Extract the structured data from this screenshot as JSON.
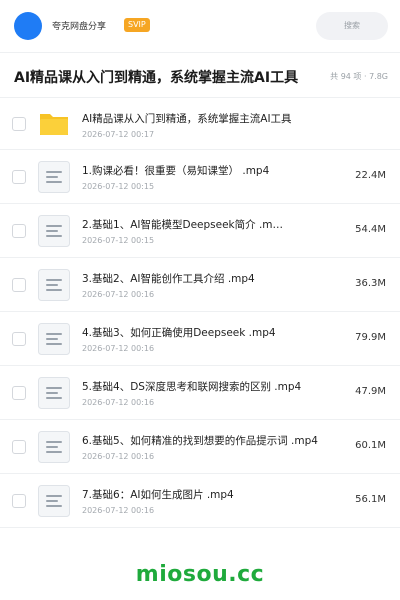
{
  "header": {
    "username": "夸克网盘分享",
    "badge": "SVIP",
    "search_placeholder": "搜索",
    "avatar_color": "#1f7cf5",
    "badge_color": "#f6a623"
  },
  "share": {
    "title": "AI精品课从入门到精通，系统掌握主流AI工具",
    "meta": "共 94 项 · 7.8G"
  },
  "files": [
    {
      "name": "AI精品课从入门到精通，系统掌握主流AI工具",
      "date": "2026-07-12 00:17",
      "size": "",
      "type": "folder"
    },
    {
      "name": "1.购课必看！很重要（易知课堂） .mp4",
      "date": "2026-07-12 00:15",
      "size": "22.4M",
      "type": "video"
    },
    {
      "name": "2.基础1、AI智能模型Deepseek简介 .m…",
      "date": "2026-07-12 00:15",
      "size": "54.4M",
      "type": "video"
    },
    {
      "name": "3.基础2、AI智能创作工具介绍 .mp4",
      "date": "2026-07-12 00:16",
      "size": "36.3M",
      "type": "video"
    },
    {
      "name": "4.基础3、如何正确使用Deepseek .mp4",
      "date": "2026-07-12 00:16",
      "size": "79.9M",
      "type": "video"
    },
    {
      "name": "5.基础4、DS深度思考和联网搜索的区别 .mp4",
      "date": "2026-07-12 00:16",
      "size": "47.9M",
      "type": "video"
    },
    {
      "name": "6.基础5、如何精准的找到想要的作品提示词 .mp4",
      "date": "2026-07-12 00:16",
      "size": "60.1M",
      "type": "video"
    },
    {
      "name": "7.基础6：AI如何生成图片 .mp4",
      "date": "2026-07-12 00:16",
      "size": "56.1M",
      "type": "video"
    }
  ],
  "watermark": {
    "text": "miosou.cc",
    "color": "#1faa3c"
  }
}
